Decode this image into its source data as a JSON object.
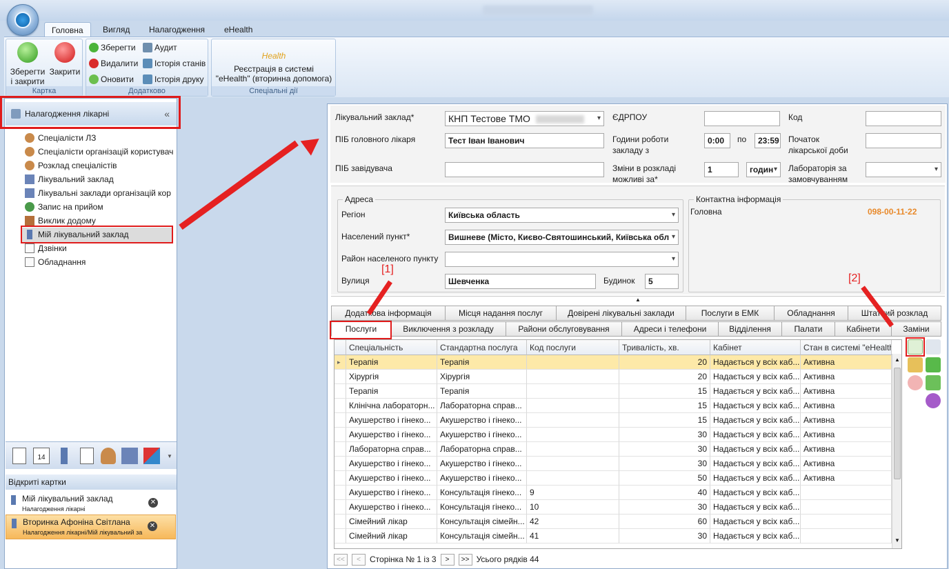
{
  "ribbon_tabs": [
    "Головна",
    "Вигляд",
    "Налагодження",
    "eHealth"
  ],
  "groups": {
    "card": {
      "label": "Картка",
      "save_close": "Зберегти\nі закрити",
      "close": "Закрити"
    },
    "extra": {
      "label": "Додатково",
      "save": "Зберегти",
      "delete": "Видалити",
      "refresh": "Оновити",
      "audit": "Аудит",
      "state_history": "Історія станів",
      "print_history": "Історія друку"
    },
    "special": {
      "label": "Спеціальні дії",
      "ehealth_logo": "Health",
      "register": "Реєстрація в системі\n\"eHealth\" (вторинна допомога)"
    }
  },
  "nav": {
    "header": "Налагодження лікарні",
    "collapse": "«",
    "items": [
      "Спеціалісти ЛЗ",
      "Спеціалісти організацій користувач",
      "Розклад спеціалістів",
      "Лікувальний заклад",
      "Лікувальні заклади організацій кор",
      "Запис на прийом",
      "Виклик додому",
      "Мій лікувальний заклад",
      "Дзвінки",
      "Обладнання"
    ]
  },
  "open_cards": {
    "header": "Відкриті картки",
    "items": [
      {
        "title": "Мій лікувальний заклад",
        "sub": "Налагодження лікарні"
      },
      {
        "title": "Вторинка Афоніна Світлана",
        "sub": "Налагодження лікарні/Мій лікувальний за"
      }
    ]
  },
  "form": {
    "facility_label": "Лікувальний заклад*",
    "facility_value": "КНП Тестове ТМО",
    "edrpou_label": "ЄДРПОУ",
    "code_label": "Код",
    "head_doctor_label": "ПІБ головного лікаря",
    "head_doctor_value": "Тест Іван Іванович",
    "hours_label": "Години роботи\nзакладу з",
    "hours_from": "0:00",
    "hours_to_label": "по",
    "hours_to": "23:59",
    "day_start_label": "Початок\nлікарської доби",
    "manager_label": "ПІБ завідувача",
    "shifts_label": "Зміни в розкладі\nможливі за*",
    "shifts_value": "1",
    "shifts_unit": "годин",
    "lab_label": "Лабораторія за\nзамовчуванням"
  },
  "address": {
    "legend": "Адреса",
    "region_label": "Регіон",
    "region_value": "Київська область",
    "city_label": "Населений пункт*",
    "city_value": "Вишневе (Місто, Києво-Святошинський, Київська обл",
    "district_label": "Район населеного пункту",
    "street_label": "Вулиця",
    "street_value": "Шевченка",
    "house_label": "Будинок",
    "house_value": "5"
  },
  "contact": {
    "legend": "Контактна інформація",
    "type": "Головна",
    "phone": "098-00-11-22"
  },
  "tabs_row1": [
    "Додаткова інформація",
    "Місця надання послуг",
    "Довірені лікувальні заклади",
    "Послуги в ЕМК",
    "Обладнання",
    "Штатний розклад"
  ],
  "tabs_row2": [
    "Послуги",
    "Виключення з розкладу",
    "Райони обслуговування",
    "Адреси і телефони",
    "Відділення",
    "Палати",
    "Кабінети",
    "Заміни"
  ],
  "grid": {
    "columns": [
      "Спеціальність",
      "Стандартна послуга",
      "Код послуги",
      "Тривалість, хв.",
      "Кабінет",
      "Стан в системі \"eHealth"
    ],
    "rows": [
      [
        "Терапія",
        "Терапія",
        "",
        "20",
        "Надається у всіх каб...",
        "Активна"
      ],
      [
        "Хірургія",
        "Хірургія",
        "",
        "20",
        "Надається у всіх каб...",
        "Активна"
      ],
      [
        "Терапія",
        "Терапія",
        "",
        "15",
        "Надається у всіх каб...",
        "Активна"
      ],
      [
        "Клінічна лабораторн...",
        "Лабораторна справ...",
        "",
        "15",
        "Надається у всіх каб...",
        "Активна"
      ],
      [
        "Акушерство і гінеко...",
        "Акушерство і гінеко...",
        "",
        "15",
        "Надається у всіх каб...",
        "Активна"
      ],
      [
        "Акушерство і гінеко...",
        "Акушерство і гінеко...",
        "",
        "30",
        "Надається у всіх каб...",
        "Активна"
      ],
      [
        "Лабораторна справ...",
        "Лабораторна справ...",
        "",
        "30",
        "Надається у всіх каб...",
        "Активна"
      ],
      [
        "Акушерство і гінеко...",
        "Акушерство і гінеко...",
        "",
        "30",
        "Надається у всіх каб...",
        "Активна"
      ],
      [
        "Акушерство і гінеко...",
        "Акушерство і гінеко...",
        "",
        "50",
        "Надається у всіх каб...",
        "Активна"
      ],
      [
        "Акушерство і гінеко...",
        "Консультація гінеко...",
        "9",
        "40",
        "Надається у всіх каб...",
        ""
      ],
      [
        "Акушерство і гінеко...",
        "Консультація гінеко...",
        "10",
        "30",
        "Надається у всіх каб...",
        ""
      ],
      [
        "Сімейний лікар",
        "Консультація сімейн...",
        "42",
        "60",
        "Надається у всіх каб...",
        ""
      ],
      [
        "Сімейний лікар",
        "Консультація сімейн...",
        "41",
        "30",
        "Надається у всіх каб...",
        ""
      ]
    ]
  },
  "pager": {
    "first": "<<",
    "prev": "<",
    "page": "Сторінка № 1 із 3",
    "next": ">",
    "last": ">>",
    "total": "Усього рядків 44"
  },
  "annotations": {
    "a1": "[1]",
    "a2": "[2]"
  },
  "colors": {
    "selected_row": "#fde9a8",
    "phone": "#e8892a",
    "annotation": "#e52121"
  }
}
